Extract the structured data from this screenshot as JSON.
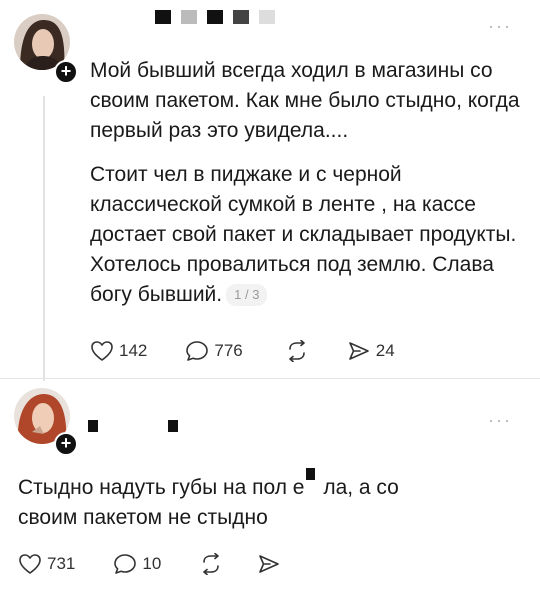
{
  "post1": {
    "paragraph1": "Мой бывший всегда ходил в магазины со своим пакетом. Как мне было стыдно, когда первый раз это увидела....",
    "paragraph2": "Стоит чел в пиджаке и с черной классической сумкой в ленте , на кассе достает свой пакет и складывает продукты. Хотелось провалиться под землю. Слава богу бывший.",
    "pager": "1 / 3",
    "likes": "142",
    "comments": "776",
    "reposts": "",
    "shares": "24",
    "menu": "···"
  },
  "post2": {
    "text_part1": "Стыдно надуть губы на пол е",
    "text_part2": " ла, а со своим пакетом не стыдно",
    "likes": "731",
    "comments": "10",
    "menu": "···"
  },
  "icons": {
    "like": "heart-icon",
    "comment": "comment-bubble-icon",
    "repost": "repost-arrows-icon",
    "share": "share-arrow-icon",
    "follow": "plus-icon"
  },
  "colors": {
    "icon": "#333333",
    "line": "#e3e3e3",
    "muted": "#9a9a9a"
  }
}
